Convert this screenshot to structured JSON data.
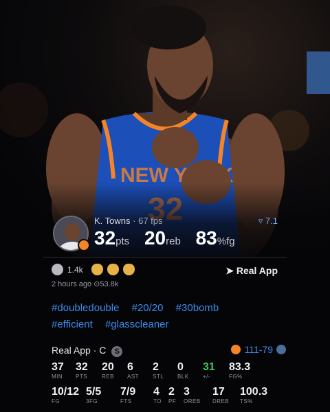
{
  "player": {
    "name": "K. Towns",
    "fps": "67 fps",
    "rating": "7.1",
    "pts": "32",
    "pts_unit": "pts",
    "reb": "20",
    "reb_unit": "reb",
    "fg": "83",
    "fg_unit": "%fg"
  },
  "reactions": {
    "count": "1.4k",
    "link_label": "Real App",
    "time": "2 hours ago",
    "views": "53.8k",
    "icons": [
      "smile-emoji",
      "cat-emoji",
      "cat-emoji",
      "cat-emoji"
    ]
  },
  "hashtags": {
    "line1": [
      "#doubledouble",
      "#20/20",
      "#30bomb"
    ],
    "line2": [
      "#efficient",
      "#glasscleaner"
    ]
  },
  "box": {
    "title": "Real App · C",
    "badge": "S",
    "score": "111-79",
    "row1": [
      {
        "v": "37",
        "l": "MIN"
      },
      {
        "v": "32",
        "l": "PTS"
      },
      {
        "v": "20",
        "l": "REB"
      },
      {
        "v": "6",
        "l": "AST"
      },
      {
        "v": "2",
        "l": "STL"
      },
      {
        "v": "0",
        "l": "BLK"
      },
      {
        "v": "31",
        "l": "+/-"
      },
      {
        "v": "83.3",
        "l": "FG%"
      }
    ],
    "row2": [
      {
        "v": "10/12",
        "l": "FG"
      },
      {
        "v": "5/5",
        "l": "3FG"
      },
      {
        "v": "7/9",
        "l": "FTS"
      },
      {
        "v": "4",
        "l": "TO"
      },
      {
        "v": "2",
        "l": "PF"
      },
      {
        "v": "3",
        "l": "OREB"
      },
      {
        "v": "17",
        "l": "DREB"
      },
      {
        "v": "100.3",
        "l": "TS%"
      }
    ]
  },
  "colors": {
    "accent_blue": "#3b8be8",
    "plus_minus_green": "#3cc45a",
    "knicks_orange": "#f58426",
    "knicks_blue": "#1d4fb8"
  }
}
